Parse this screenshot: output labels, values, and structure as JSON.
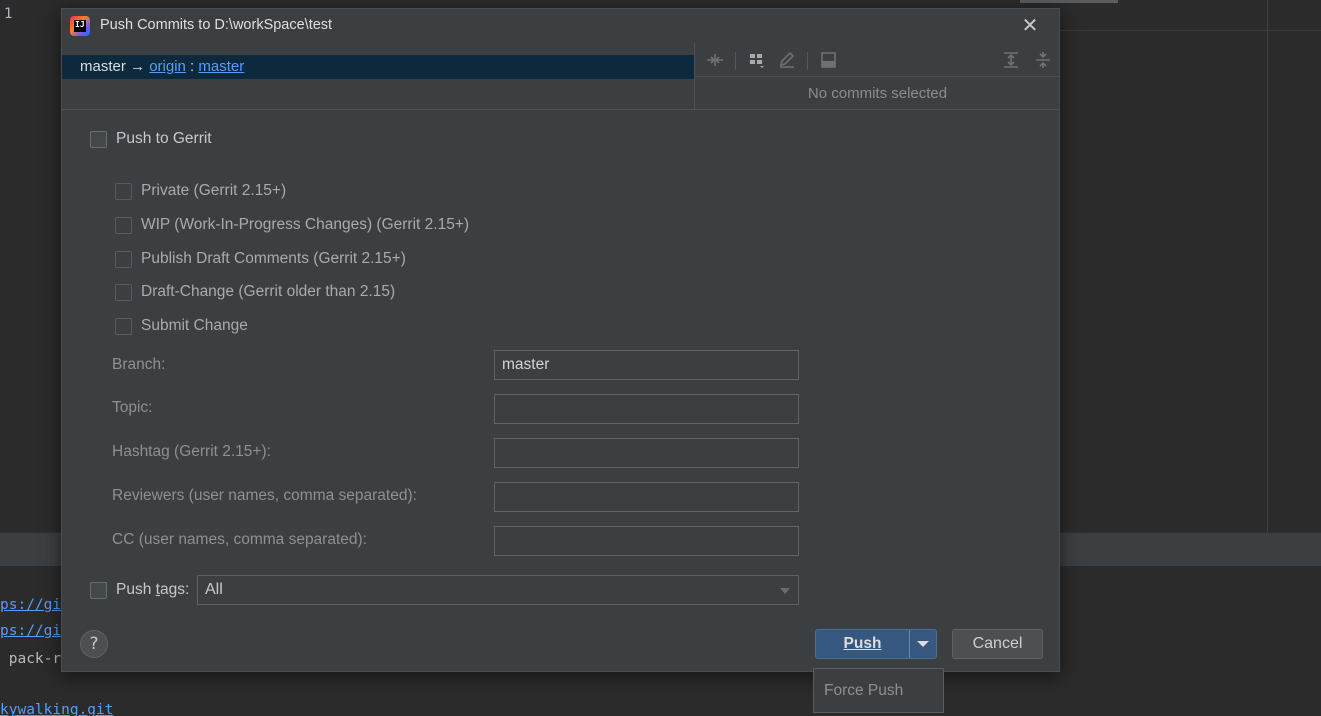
{
  "background": {
    "line_number": "1",
    "console_lines": [
      {
        "text": "ps://gi",
        "kind": "link"
      },
      {
        "text": "ps://gi",
        "kind": "link"
      },
      {
        "text": " pack-r",
        "kind": "plain"
      },
      {
        "text": "",
        "kind": "plain"
      },
      {
        "text": "kywalking.git",
        "kind": "link"
      }
    ]
  },
  "dialog": {
    "title": "Push Commits to D:\\workSpace\\test",
    "app_icon": "intellij-idea-icon",
    "close_icon": "close-icon",
    "branch_row": {
      "local": "master",
      "arrow": "→",
      "remote": "origin",
      "separator": ":",
      "target": "master"
    },
    "toolbar_icons": [
      "merge-arrows-icon",
      "group-by-icon",
      "edit-icon",
      "show-details-icon",
      "expand-all-icon",
      "collapse-all-icon"
    ],
    "no_commits_text": "No commits selected",
    "push_to_gerrit": {
      "label": "Push to Gerrit",
      "checked": false
    },
    "gerrit_options": [
      {
        "label": "Private (Gerrit 2.15+)",
        "checked": false
      },
      {
        "label": "WIP (Work-In-Progress Changes) (Gerrit 2.15+)",
        "checked": false
      },
      {
        "label": "Publish Draft Comments (Gerrit 2.15+)",
        "checked": false
      },
      {
        "label": "Draft-Change (Gerrit older than 2.15)",
        "checked": false
      },
      {
        "label": "Submit Change",
        "checked": false
      }
    ],
    "fields": [
      {
        "label": "Branch:",
        "value": "master"
      },
      {
        "label": "Topic:",
        "value": ""
      },
      {
        "label": "Hashtag (Gerrit 2.15+):",
        "value": ""
      },
      {
        "label": "Reviewers (user names, comma separated):",
        "value": ""
      },
      {
        "label": "CC (user names, comma separated):",
        "value": ""
      }
    ],
    "push_tags": {
      "label_prefix": "Push ",
      "label_mnemonic": "t",
      "label_suffix": "ags:",
      "checked": false,
      "selected": "All"
    },
    "help_label": "?",
    "push_label": "Push",
    "cancel_label": "Cancel",
    "force_push_label": "Force Push"
  },
  "colors": {
    "dialog_bg": "#3c3f41",
    "selection_bg": "#0d293e",
    "link": "#589df6",
    "primary_button": "#365880"
  }
}
